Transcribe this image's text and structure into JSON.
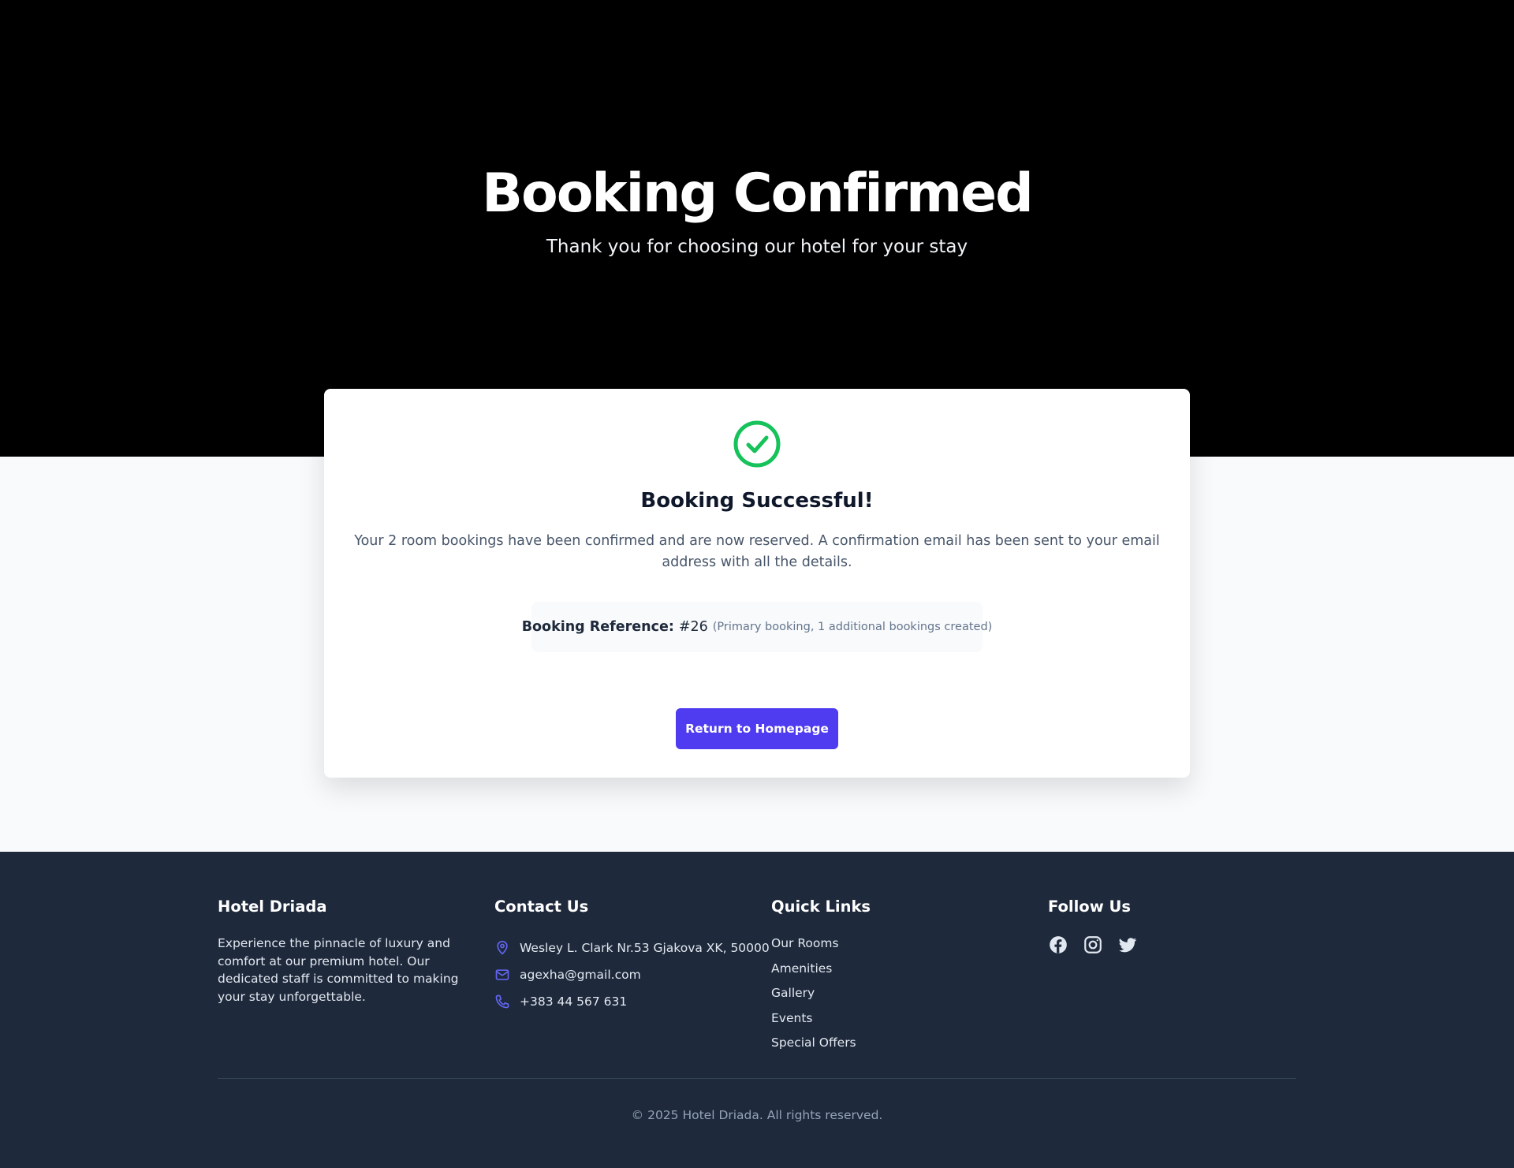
{
  "hero": {
    "title": "Booking Confirmed",
    "subtitle": "Thank you for choosing our hotel for your stay"
  },
  "confirmation": {
    "icon": "check-circle-icon",
    "title": "Booking Successful!",
    "message": "Your 2 room bookings have been confirmed and are now reserved. A confirmation email has been sent to your email address with all the details.",
    "reference_label": "Booking Reference:",
    "reference_value": "#26",
    "reference_note": "(Primary booking, 1 additional bookings created)",
    "return_button": "Return to Homepage"
  },
  "footer": {
    "about": {
      "title": "Hotel Driada",
      "text": "Experience the pinnacle of luxury and comfort at our premium hotel. Our dedicated staff is committed to making your stay unforgettable."
    },
    "contact": {
      "title": "Contact Us",
      "items": [
        {
          "icon": "map-pin-icon",
          "text": "Wesley L. Clark Nr.53 Gjakova XK, 50000"
        },
        {
          "icon": "mail-icon",
          "text": "agexha@gmail.com"
        },
        {
          "icon": "phone-icon",
          "text": "+383 44 567 631"
        }
      ]
    },
    "links": {
      "title": "Quick Links",
      "items": [
        "Our Rooms",
        "Amenities",
        "Gallery",
        "Events",
        "Special Offers"
      ]
    },
    "social": {
      "title": "Follow Us",
      "icons": [
        "facebook-icon",
        "instagram-icon",
        "twitter-icon"
      ]
    },
    "copyright": "© 2025 Hotel Driada. All rights reserved."
  },
  "colors": {
    "hero_bg": "#000000",
    "accent": "#4f3bf0",
    "success": "#16c25a",
    "footer_bg": "#1e293b",
    "contact_icon": "#6366f1"
  }
}
